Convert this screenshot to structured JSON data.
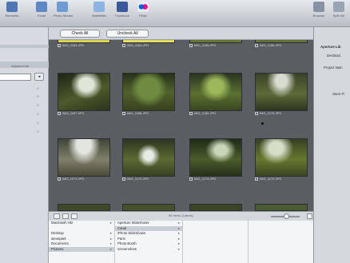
{
  "toolbar": {
    "buttons": [
      {
        "label": "Elements",
        "icon": "folder-icon",
        "color": "#4f77b3"
      },
      {
        "label": "Email",
        "icon": "email-icon",
        "color": "#5f86c6"
      },
      {
        "label": "Photo Stream",
        "icon": "photo-stream-icon",
        "color": "#6d9bd2"
      },
      {
        "label": "MobileMe",
        "icon": "mobileme-icon",
        "color": "#8bb5e0"
      },
      {
        "label": "Facebook",
        "icon": "facebook-icon",
        "color": "#3b5998"
      },
      {
        "label": "Flickr",
        "icon": "flickr-icon",
        "color": "#d94a8a"
      }
    ],
    "right_buttons": [
      {
        "label": "Browser",
        "icon": "browser-icon"
      },
      {
        "label": "Split Vie",
        "icon": "split-view-icon"
      }
    ]
  },
  "left_panel": {
    "adjustments_label": "Adjustments"
  },
  "check_bar": {
    "check_all": "Check All",
    "uncheck_all": "Uncheck All"
  },
  "grid": {
    "items": [
      {
        "caption": "IMG_1163.JPG"
      },
      {
        "caption": "IMG_1164.JPG"
      },
      {
        "caption": "IMG_1165.JPG"
      },
      {
        "caption": "IMG_1166.JPG"
      },
      {
        "caption": "IMG_1167.JPG"
      },
      {
        "caption": "IMG_1168.JPG"
      },
      {
        "caption": "IMG_1169.JPG"
      },
      {
        "caption": "IMG_1170.JPG"
      },
      {
        "caption": "IMG_1171.JPG"
      },
      {
        "caption": "IMG_1172.JPG"
      },
      {
        "caption": "IMG_1173.JPG"
      },
      {
        "caption": "IMG_1174.JPG"
      }
    ]
  },
  "status": {
    "count": "96 items (Labels)"
  },
  "browser": {
    "col1": [
      "Macintosh HD",
      "",
      "Desktop",
      "stevepark",
      "Documents",
      "Pictures"
    ],
    "col2": [
      "Aperture Slideshows",
      "Canal",
      "iPhoto Slideshows",
      "Paris",
      "Photo Booth",
      "Screenshots"
    ],
    "selected_col2": 1
  },
  "right_panel": {
    "title": "Aperture Lib",
    "destination": "Destinati",
    "project_name": "Project Nam",
    "store_files": "Store Fi"
  }
}
